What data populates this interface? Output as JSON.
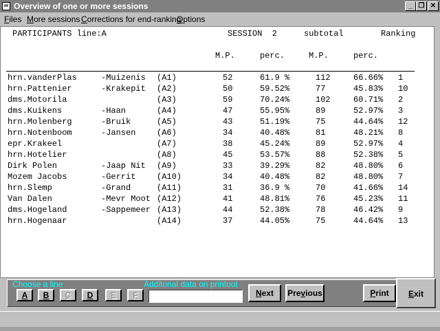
{
  "window": {
    "title": "Overview of one or more sessions"
  },
  "menu": [
    {
      "label": "Files",
      "u": "F",
      "rest": "iles"
    },
    {
      "label": "More sessions",
      "u": "M",
      "rest": "ore sessions"
    },
    {
      "label": "Corrections for end-ranking",
      "u": "C",
      "rest": "orrections for end-ranking"
    },
    {
      "label": "Options",
      "u": "O",
      "rest": "ptions"
    }
  ],
  "report": {
    "participants_label": "PARTICIPANTS line:A",
    "session_label": "SESSION  2",
    "subtotal_label": "subtotal",
    "ranking_label": "Ranking",
    "col_mp1": "M.P.",
    "col_perc1": "perc.",
    "col_mp2": "M.P.",
    "col_perc2": "perc.",
    "rows": [
      {
        "p1": "hrn.vanderPlas",
        "p2": "-Muizenis",
        "code": "(A1)",
        "mp": "52",
        "perc": "61.9 %",
        "mp_total": "112",
        "perc_total": "66.66%",
        "rank": "1"
      },
      {
        "p1": "hrn.Pattenier",
        "p2": "-Krakepit",
        "code": "(A2)",
        "mp": "50",
        "perc": "59.52%",
        "mp_total": "77",
        "perc_total": "45.83%",
        "rank": "10"
      },
      {
        "p1": "dms.Motorila",
        "p2": "",
        "code": "(A3)",
        "mp": "59",
        "perc": "70.24%",
        "mp_total": "102",
        "perc_total": "60.71%",
        "rank": "2"
      },
      {
        "p1": "dms.Kuikens",
        "p2": "-Haan",
        "code": "(A4)",
        "mp": "47",
        "perc": "55.95%",
        "mp_total": "89",
        "perc_total": "52.97%",
        "rank": "3"
      },
      {
        "p1": "hrn.Molenberg",
        "p2": "-Bruik",
        "code": "(A5)",
        "mp": "43",
        "perc": "51.19%",
        "mp_total": "75",
        "perc_total": "44.64%",
        "rank": "12"
      },
      {
        "p1": "hrn.Notenboom",
        "p2": "-Jansen",
        "code": "(A6)",
        "mp": "34",
        "perc": "40.48%",
        "mp_total": "81",
        "perc_total": "48.21%",
        "rank": "8"
      },
      {
        "p1": "epr.Krakeel",
        "p2": "",
        "code": "(A7)",
        "mp": "38",
        "perc": "45.24%",
        "mp_total": "89",
        "perc_total": "52.97%",
        "rank": "4"
      },
      {
        "p1": "hrn.Hotelier",
        "p2": "",
        "code": "(A8)",
        "mp": "45",
        "perc": "53.57%",
        "mp_total": "88",
        "perc_total": "52.38%",
        "rank": "5"
      },
      {
        "p1": "Dirk Polen",
        "p2": "-Jaap Nit",
        "code": "(A9)",
        "mp": "33",
        "perc": "39.29%",
        "mp_total": "82",
        "perc_total": "48.80%",
        "rank": "6"
      },
      {
        "p1": "Mozem Jacobs",
        "p2": "-Gerrit",
        "code": "(A10)",
        "mp": "34",
        "perc": "40.48%",
        "mp_total": "82",
        "perc_total": "48.80%",
        "rank": "7"
      },
      {
        "p1": "hrn.Slemp",
        "p2": "-Grand",
        "code": "(A11)",
        "mp": "31",
        "perc": "36.9 %",
        "mp_total": "70",
        "perc_total": "41.66%",
        "rank": "14"
      },
      {
        "p1": "Van Dalen",
        "p2": "-Mevr Moot",
        "code": "(A12)",
        "mp": "41",
        "perc": "48.81%",
        "mp_total": "76",
        "perc_total": "45.23%",
        "rank": "11"
      },
      {
        "p1": "dms.Hogeland",
        "p2": "-Sappemeer",
        "code": "(A13)",
        "mp": "44",
        "perc": "52.38%",
        "mp_total": "78",
        "perc_total": "46.42%",
        "rank": "9"
      },
      {
        "p1": "hrn.Hogenaar",
        "p2": "",
        "code": "(A14)",
        "mp": "37",
        "perc": "44.05%",
        "mp_total": "75",
        "perc_total": "44.64%",
        "rank": "13"
      }
    ]
  },
  "bottom": {
    "choose_line_label": "Choose a line",
    "additional_data_label": "Additonal data on printout",
    "additional_data_value": "",
    "line_buttons": [
      {
        "label": "A",
        "enabled": true
      },
      {
        "label": "B",
        "enabled": true
      },
      {
        "label": "C",
        "enabled": false
      },
      {
        "label": "D",
        "enabled": true
      },
      {
        "label": "E",
        "enabled": false
      },
      {
        "label": "F",
        "enabled": false
      }
    ],
    "next": {
      "u": "N",
      "rest": "ext"
    },
    "previous": {
      "pre": "Pre",
      "u": "v",
      "rest": "ious"
    },
    "print": {
      "u": "P",
      "rest": "rint"
    },
    "exit": {
      "u": "E",
      "rest": "xit"
    }
  },
  "colors": {
    "panel_label": "#00ffff",
    "panel_bg": "#808080",
    "face": "#c0c0c0"
  }
}
